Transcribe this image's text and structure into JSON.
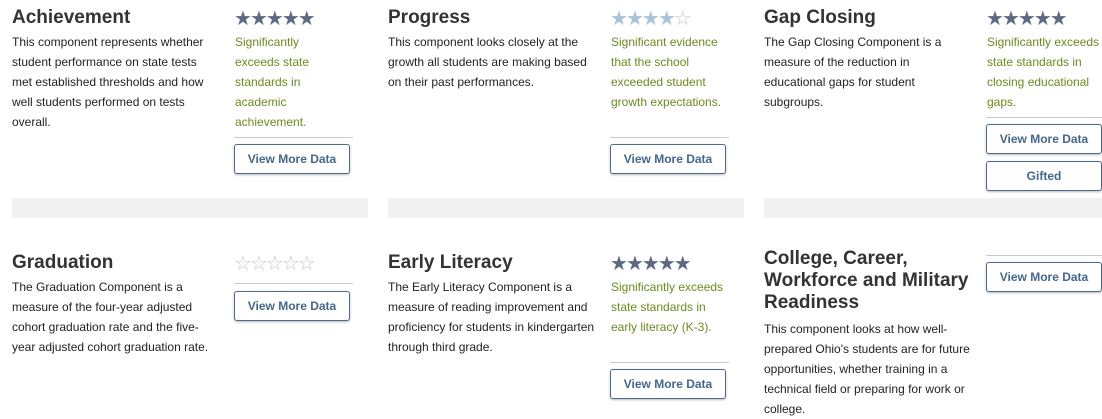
{
  "colors": {
    "star_filled": "#5e6a82",
    "star_progress": "#a9c3dd",
    "star_empty": "#dcdcdc",
    "rating_text": "#6c8a1f",
    "button_text": "#456789"
  },
  "cards": {
    "achievement": {
      "title": "Achievement",
      "description": "This component represents whether student performance on state tests met established thresholds and how well students performed on tests overall.",
      "stars": 5,
      "star_glyph": "filled-star-icon",
      "rating": "Significantly exceeds state standards in academic achievement.",
      "buttons": [
        "View More Data"
      ]
    },
    "progress": {
      "title": "Progress",
      "description": "This component looks closely at the growth all students are making based on their past performances.",
      "stars": 4,
      "star_glyph": "filled-star-icon",
      "rating": "Significant evidence that the school exceeded student growth expectations.",
      "buttons": [
        "View More Data"
      ]
    },
    "gap_closing": {
      "title": "Gap Closing",
      "description": "The Gap Closing Component is a measure of the reduction in educational gaps for student subgroups.",
      "stars": 5,
      "star_glyph": "filled-star-icon",
      "rating": "Significantly exceeds state standards in closing educational gaps.",
      "buttons": [
        "View More Data",
        "Gifted"
      ]
    },
    "graduation": {
      "title": "Graduation",
      "description": "The Graduation Component is a measure of the four-year adjusted cohort graduation rate and the five-year adjusted cohort graduation rate.",
      "stars": 0,
      "star_glyph": "empty-star-icon",
      "rating": "",
      "buttons": [
        "View More Data"
      ]
    },
    "early_literacy": {
      "title": "Early Literacy",
      "description": "The Early Literacy Component is a measure of reading improvement and proficiency for students in kindergarten through third grade.",
      "stars": 5,
      "star_glyph": "filled-star-icon",
      "rating": "Significantly exceeds state standards in early literacy (K-3).",
      "buttons": [
        "View More Data"
      ]
    },
    "readiness": {
      "title": "College, Career, Workforce and Military Readiness",
      "description": "This component looks at how well-prepared Ohio's students are for future opportunities, whether training in a technical field or preparing for work or college.",
      "buttons": [
        "View More Data"
      ]
    }
  }
}
